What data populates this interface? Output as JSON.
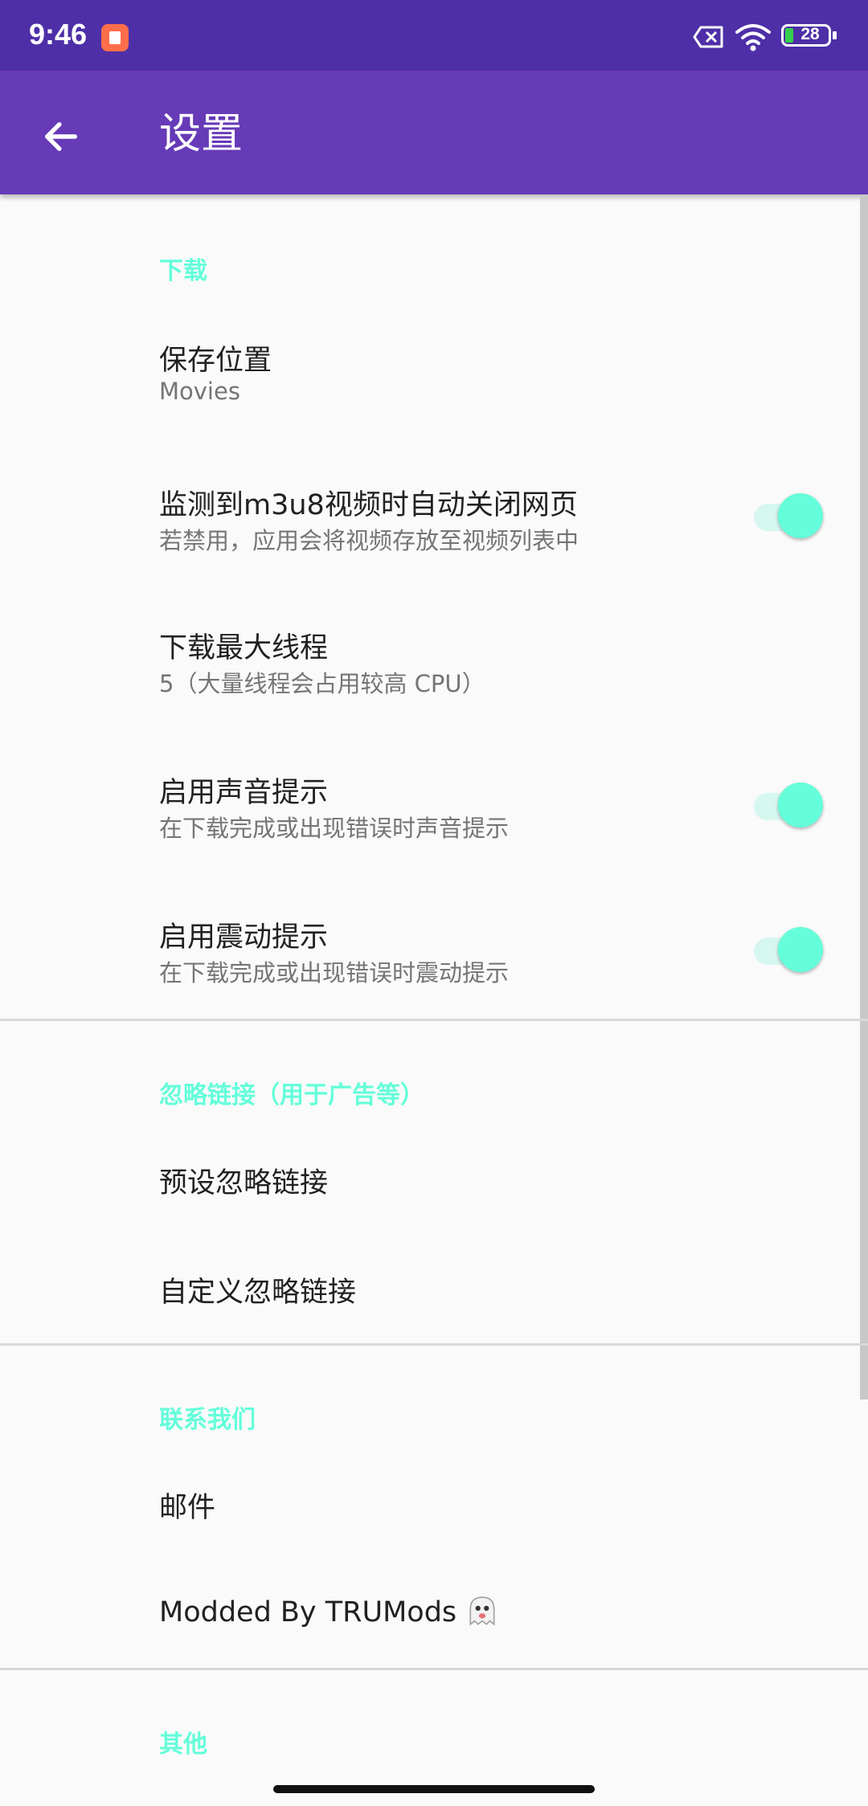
{
  "status_bar": {
    "time": "9:46",
    "battery_level": "28"
  },
  "app_bar": {
    "title": "设置"
  },
  "sections": {
    "download": {
      "header": "下载",
      "save_location": {
        "title": "保存位置",
        "summary": "Movies"
      },
      "auto_close": {
        "title": "监测到m3u8视频时自动关闭网页",
        "summary": "若禁用，应用会将视频存放至视频列表中",
        "enabled": true
      },
      "max_threads": {
        "title": "下载最大线程",
        "summary": "5（大量线程会占用较高 CPU）"
      },
      "sound_alert": {
        "title": "启用声音提示",
        "summary": "在下载完成或出现错误时声音提示",
        "enabled": true
      },
      "vibrate_alert": {
        "title": "启用震动提示",
        "summary": "在下载完成或出现错误时震动提示",
        "enabled": true
      }
    },
    "ignore_links": {
      "header": "忽略链接（用于广告等）",
      "preset": {
        "title": "预设忽略链接"
      },
      "custom": {
        "title": "自定义忽略链接"
      }
    },
    "contact": {
      "header": "联系我们",
      "email": {
        "title": "邮件"
      },
      "modded": {
        "title": "Modded By TRUMods"
      }
    },
    "other": {
      "header": "其他"
    }
  },
  "colors": {
    "accent": "#64ffda",
    "primary": "#673ab7",
    "primary_dark": "#4e2fa7"
  }
}
